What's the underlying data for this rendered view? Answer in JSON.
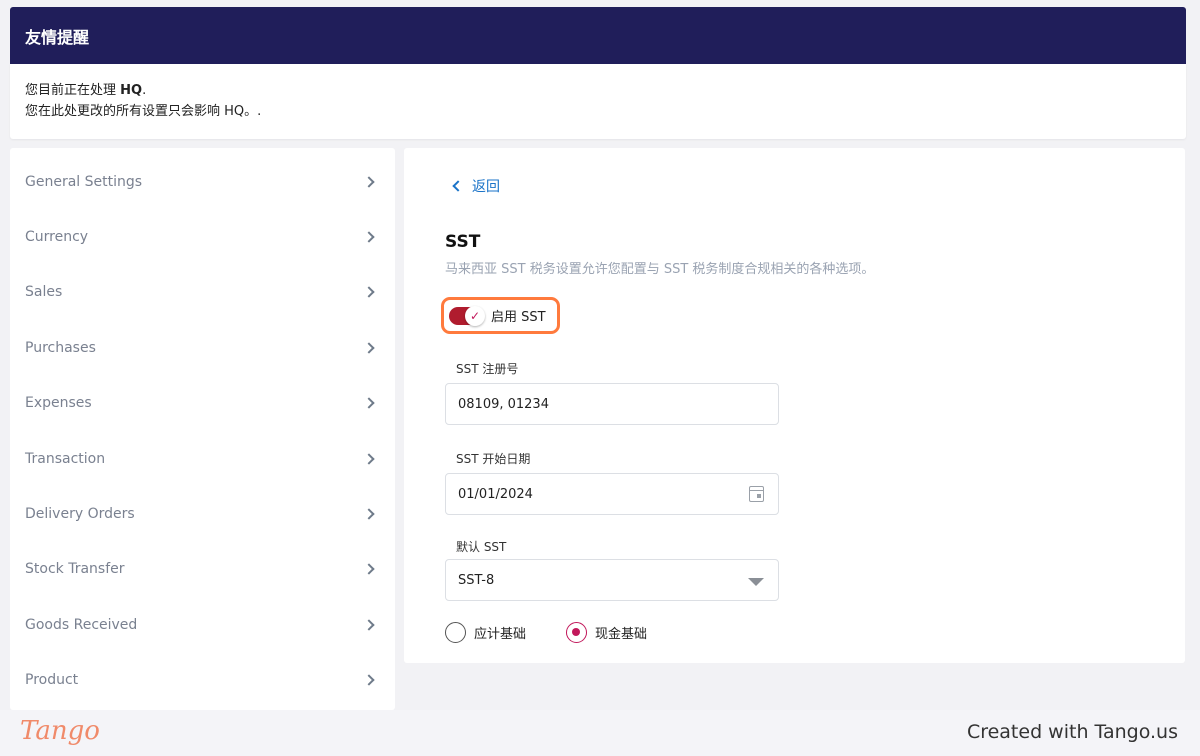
{
  "banner": {
    "title": "友情提醒",
    "line1_prefix": "您目前正在处理 ",
    "line1_bold": "HQ",
    "line1_suffix": ".",
    "line2": "您在此处更改的所有设置只会影响 HQ。."
  },
  "sidebar": {
    "items": [
      {
        "label": "General Settings"
      },
      {
        "label": "Currency"
      },
      {
        "label": "Sales"
      },
      {
        "label": "Purchases"
      },
      {
        "label": "Expenses"
      },
      {
        "label": "Transaction"
      },
      {
        "label": "Delivery Orders"
      },
      {
        "label": "Stock Transfer"
      },
      {
        "label": "Goods Received"
      },
      {
        "label": "Product"
      }
    ]
  },
  "main": {
    "back_label": "返回",
    "title": "SST",
    "description": "马来西亚 SST 税务设置允许您配置与 SST 税务制度合规相关的各种选项。",
    "toggle": {
      "label": "启用 SST",
      "checked": true
    },
    "reg_no": {
      "label": "SST 注册号",
      "value": "08109, 01234"
    },
    "start_date": {
      "label": "SST 开始日期",
      "value": "01/01/2024"
    },
    "default_sst": {
      "label": "默认 SST",
      "value": "SST-8"
    },
    "radios": [
      {
        "label": "应计基础",
        "selected": false
      },
      {
        "label": "现金基础",
        "selected": true
      }
    ],
    "accent_color": "#c2185b"
  },
  "footer": {
    "logo": "Tango",
    "text": "Created with Tango.us"
  }
}
